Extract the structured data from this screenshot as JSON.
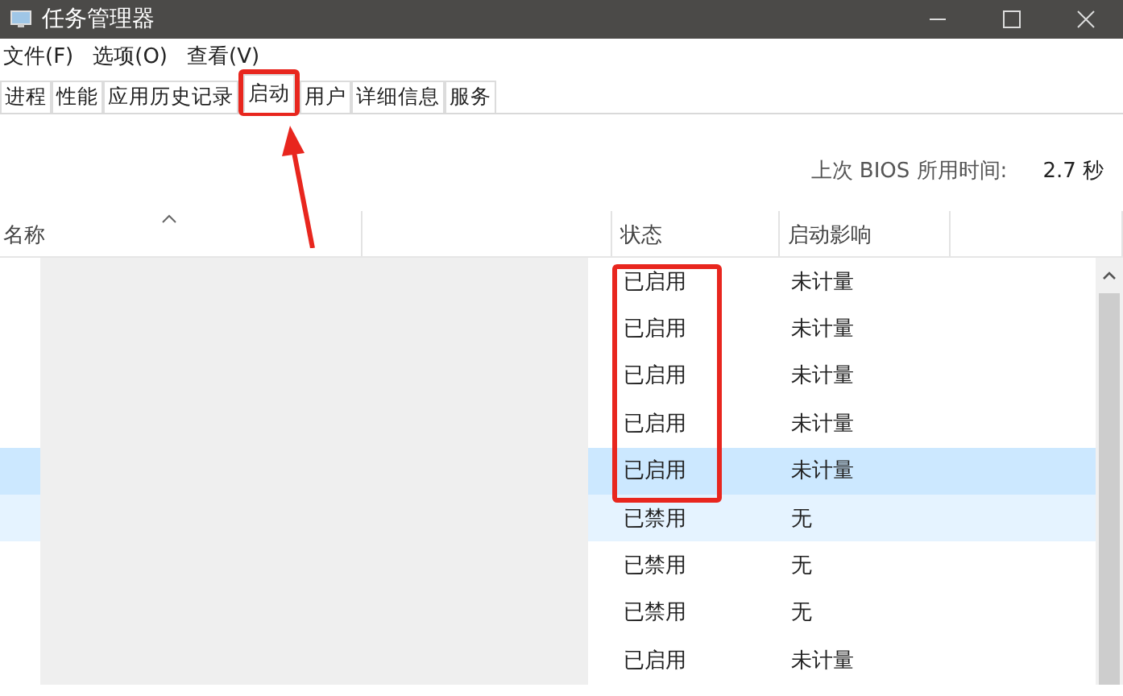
{
  "window": {
    "title": "任务管理器"
  },
  "menu": [
    "文件(F)",
    "选项(O)",
    "查看(V)"
  ],
  "tabs": [
    {
      "label": "进程",
      "selected": false
    },
    {
      "label": "性能",
      "selected": false
    },
    {
      "label": "应用历史记录",
      "selected": false
    },
    {
      "label": "启动",
      "selected": true
    },
    {
      "label": "用户",
      "selected": false
    },
    {
      "label": "详细信息",
      "selected": false
    },
    {
      "label": "服务",
      "selected": false
    }
  ],
  "bios": {
    "label": "上次 BIOS 所用时间:",
    "value": "2.7 秒"
  },
  "table": {
    "columns": {
      "name": "名称",
      "status": "状态",
      "impact": "启动影响"
    },
    "rows": [
      {
        "status": "已启用",
        "impact": "未计量",
        "selected": false,
        "hovered": false
      },
      {
        "status": "已启用",
        "impact": "未计量",
        "selected": false,
        "hovered": false
      },
      {
        "status": "已启用",
        "impact": "未计量",
        "selected": false,
        "hovered": false
      },
      {
        "status": "已启用",
        "impact": "未计量",
        "selected": false,
        "hovered": false
      },
      {
        "status": "已启用",
        "impact": "未计量",
        "selected": true,
        "hovered": false
      },
      {
        "status": "已禁用",
        "impact": "无",
        "selected": false,
        "hovered": true
      },
      {
        "status": "已禁用",
        "impact": "无",
        "selected": false,
        "hovered": false
      },
      {
        "status": "已禁用",
        "impact": "无",
        "selected": false,
        "hovered": false
      },
      {
        "status": "已启用",
        "impact": "未计量",
        "selected": false,
        "hovered": false
      }
    ]
  }
}
